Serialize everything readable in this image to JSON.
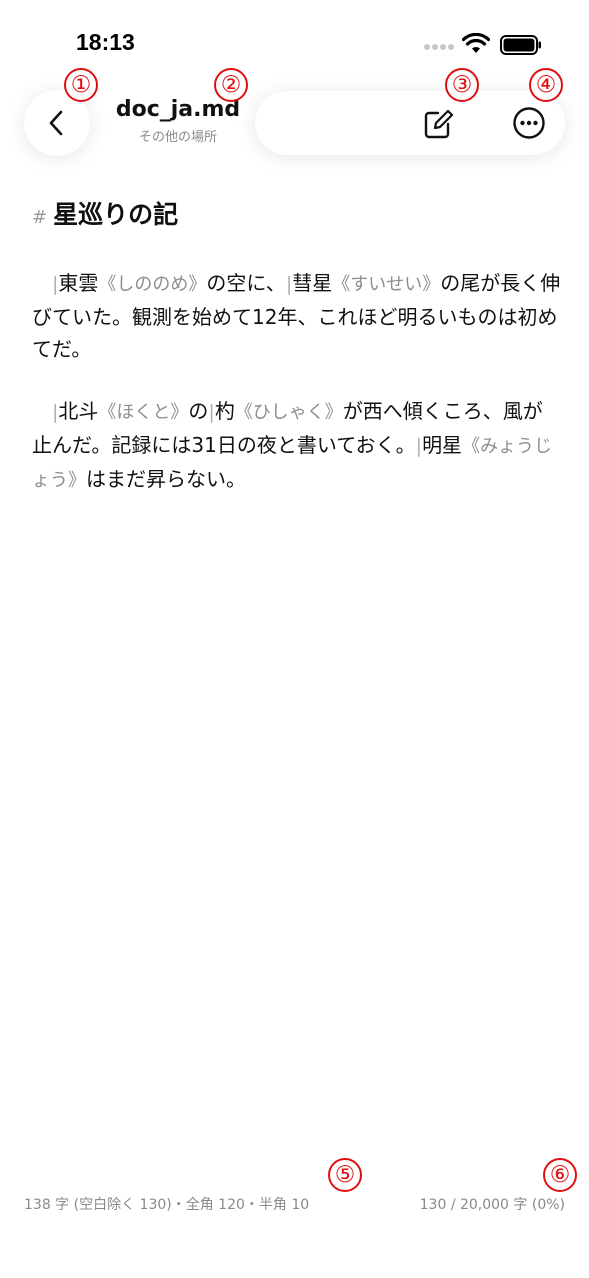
{
  "status_bar": {
    "time": "18:13"
  },
  "header": {
    "title": "doc_ja.md",
    "subtitle": "その他の場所"
  },
  "icons": {
    "back": "chevron-left-icon",
    "edit": "edit-square-pencil-icon",
    "more": "more-ellipsis-circle-icon"
  },
  "callouts": [
    "①",
    "②",
    "③",
    "④",
    "⑤",
    "⑥"
  ],
  "document": {
    "heading_marker": "#",
    "heading": "星巡りの記",
    "paragraphs": [
      [
        {
          "type": "bar",
          "text": "|"
        },
        {
          "type": "text",
          "text": "東雲"
        },
        {
          "type": "ruby",
          "text": "《しののめ》"
        },
        {
          "type": "text",
          "text": "の空に、"
        },
        {
          "type": "bar",
          "text": "|"
        },
        {
          "type": "text",
          "text": "彗星"
        },
        {
          "type": "ruby",
          "text": "《すいせい》"
        },
        {
          "type": "text",
          "text": "の尾が長く伸びていた。観測を始めて12年、これほど明るいものは初めてだ。"
        }
      ],
      [
        {
          "type": "bar",
          "text": "|"
        },
        {
          "type": "text",
          "text": "北斗"
        },
        {
          "type": "ruby",
          "text": "《ほくと》"
        },
        {
          "type": "text",
          "text": "の"
        },
        {
          "type": "bar",
          "text": "|"
        },
        {
          "type": "text",
          "text": "杓"
        },
        {
          "type": "ruby",
          "text": "《ひしゃく》"
        },
        {
          "type": "text",
          "text": "が西へ傾くころ、風が止んだ。記録には31日の夜と書いておく。"
        },
        {
          "type": "bar",
          "text": "|"
        },
        {
          "type": "text",
          "text": "明星"
        },
        {
          "type": "ruby",
          "text": "《みょうじょう》"
        },
        {
          "type": "text",
          "text": "はまだ昇らない。"
        }
      ]
    ]
  },
  "footer": {
    "stats": "138 字 (空白除く 130)・全角 120・半角 10",
    "progress": "130 / 20,000 字 (0%)"
  },
  "colors": {
    "callout": "#e01010",
    "ruby": "#8e8e8e",
    "muted": "#8a8a8a"
  }
}
